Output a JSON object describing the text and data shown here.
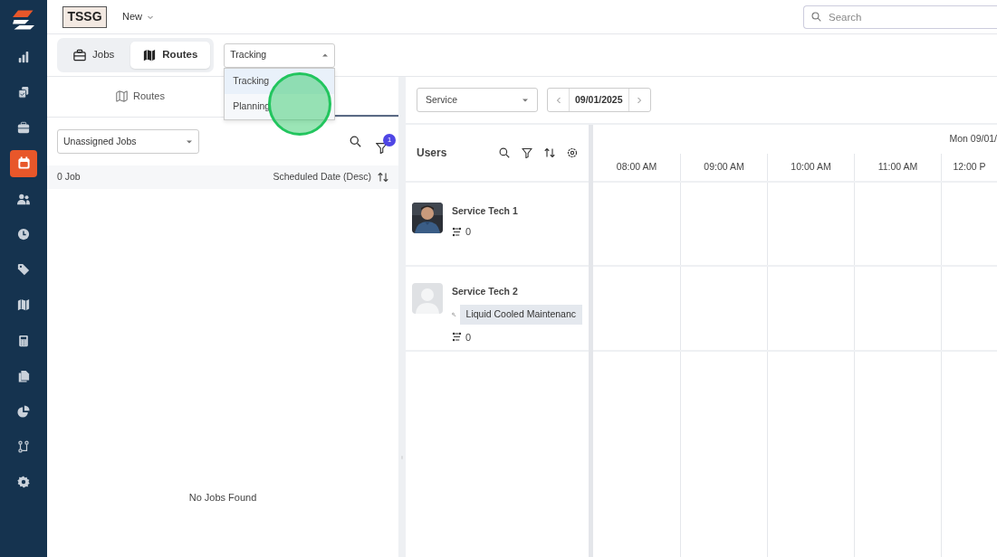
{
  "sidebar": {
    "items": [
      {
        "selected": false
      },
      {
        "selected": false
      },
      {
        "selected": false
      },
      {
        "selected": true
      },
      {
        "selected": false
      },
      {
        "selected": false
      },
      {
        "selected": false
      },
      {
        "selected": false
      },
      {
        "selected": false
      },
      {
        "selected": false
      },
      {
        "selected": false
      },
      {
        "selected": false
      },
      {
        "selected": false
      }
    ]
  },
  "header": {
    "logo": "TSSG",
    "new_menu": "New",
    "search": {
      "placeholder": "Search"
    }
  },
  "view_tabs": [
    {
      "label": "Jobs",
      "selected": false
    },
    {
      "label": "Routes",
      "selected": true
    }
  ],
  "mode_select": {
    "value": "Tracking",
    "expanded": true,
    "options": [
      {
        "label": "Tracking",
        "selected": true
      },
      {
        "label": "Planning",
        "selected": false
      }
    ]
  },
  "left_panel": {
    "tabs": [
      {
        "label": "Routes",
        "selected": false
      },
      {
        "selected": true
      }
    ],
    "job_filter": "Unassigned Jobs",
    "filter_count": "1",
    "job_count": "0 Job",
    "sort": "Scheduled Date (Desc)",
    "empty_message": "No Jobs Found"
  },
  "schedule": {
    "type_select": "Service",
    "date": "09/01/2025",
    "day": "Mon 09/01/",
    "users_title": "Users",
    "hours": [
      "08:00 AM",
      "09:00 AM",
      "10:00 AM",
      "11:00 AM",
      "12:00 P"
    ],
    "users": [
      {
        "name": "Service Tech 1",
        "has_photo": true,
        "routes": "0"
      },
      {
        "name": "Service Tech 2",
        "has_photo": false,
        "skill": "Liquid Cooled Maintenanc",
        "routes": "0"
      }
    ]
  },
  "click_marker": true
}
